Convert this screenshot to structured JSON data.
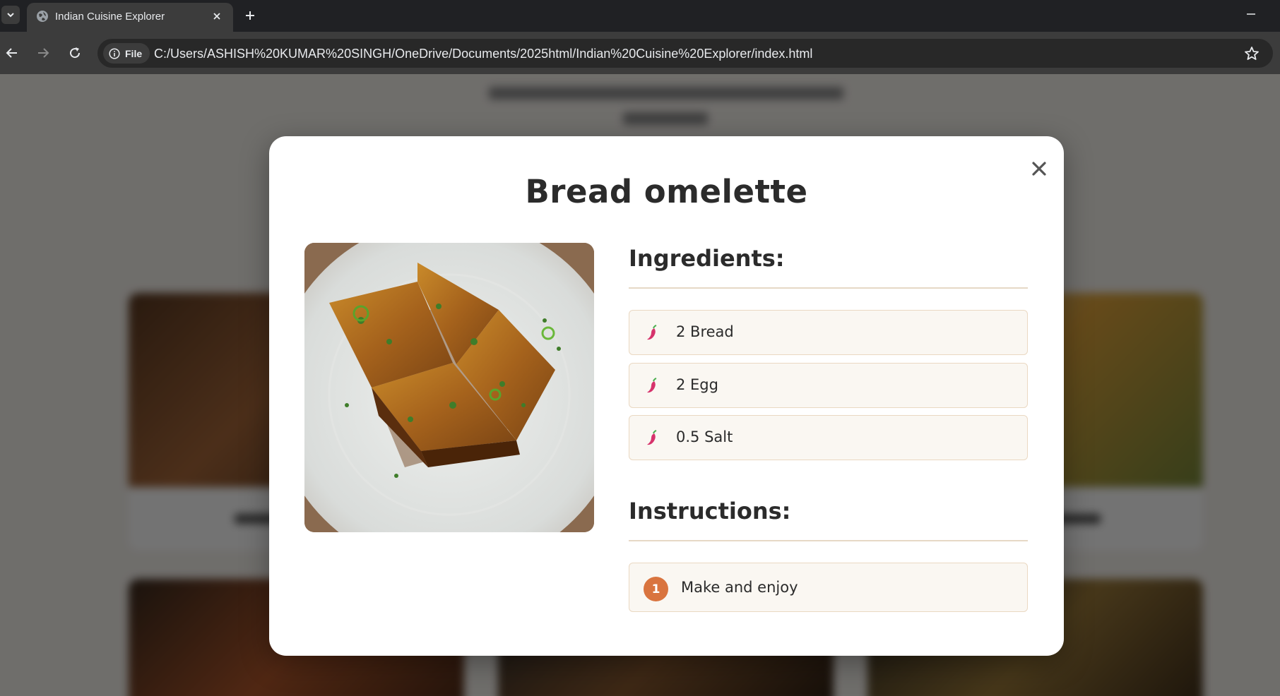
{
  "browser": {
    "tab_title": "Indian Cuisine Explorer",
    "site_chip_label": "File",
    "url": "C:/Users/ASHISH%20KUMAR%20SINGH/OneDrive/Documents/2025html/Indian%20Cuisine%20Explorer/index.html",
    "icons": {
      "tab_search": "chevron-down-icon",
      "favicon": "globe-icon",
      "tab_close": "close-icon",
      "new_tab": "plus-icon",
      "minimize": "minimize-icon",
      "back": "back-arrow-icon",
      "forward": "forward-arrow-icon",
      "reload": "reload-icon",
      "info": "info-icon",
      "bookmark": "star-icon"
    }
  },
  "modal": {
    "title": "Bread omelette",
    "ingredients_heading": "Ingredients:",
    "instructions_heading": "Instructions:",
    "ingredients": [
      {
        "text": "2 Bread",
        "icon": "chili-icon"
      },
      {
        "text": "2 Egg",
        "icon": "chili-icon"
      },
      {
        "text": "0.5 Salt",
        "icon": "chili-icon"
      }
    ],
    "instructions": [
      {
        "step": "1",
        "text": "Make and enjoy"
      }
    ],
    "close_icon": "close-icon"
  },
  "colors": {
    "accent": "#d9743f",
    "chili": "#d6336c",
    "item_background": "#faf7f2",
    "item_border": "#ead8c2"
  }
}
